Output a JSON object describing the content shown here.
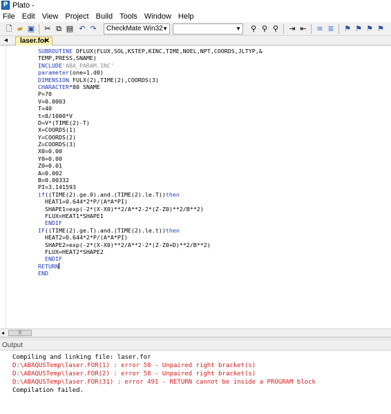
{
  "window": {
    "title": "Plato -",
    "app_icon": "plato-app-icon"
  },
  "menu": [
    "File",
    "Edit",
    "View",
    "Project",
    "Build",
    "Tools",
    "Window",
    "Help"
  ],
  "toolbar": {
    "build_config": "CheckMate Win32",
    "second_combo": "",
    "icons": [
      "new-file-icon",
      "open-folder-icon",
      "save-icon",
      "cut-icon",
      "copy-icon",
      "paste-icon",
      "undo-icon",
      "redo-icon",
      "binoculars-find-icon",
      "find-next-icon",
      "find-in-files-icon",
      "indent-icon",
      "outdent-icon",
      "comment-icon",
      "uncomment-icon",
      "bookmark-icon",
      "next-bookmark-icon",
      "prev-bookmark-icon",
      "clear-bookmarks-icon"
    ]
  },
  "tab": {
    "label": "laser.for"
  },
  "code": [
    [
      [
        "kw",
        "SUBROUTINE"
      ],
      [
        "t",
        " DFLUX(FLUX,SOL,KSTEP,KINC,TIME,NOEL,NPT,COORDS,JLTYP,&"
      ]
    ],
    [
      [
        "t",
        "TEMP,PRESS,SNAME)"
      ]
    ],
    [
      [
        "kw",
        "INCLUDE"
      ],
      [
        "str",
        "'ABA_PARAM.INC'"
      ]
    ],
    [
      [
        "kw",
        "parameter"
      ],
      [
        "t",
        "(one=1.d0)"
      ]
    ],
    [
      [
        "kw",
        "DIMENSION"
      ],
      [
        "t",
        " FULX(2),TIME(2),COORDS(3)"
      ]
    ],
    [
      [
        "kw",
        "CHARACTER"
      ],
      [
        "t",
        "*80 SNAME"
      ]
    ],
    [
      [
        "t",
        "P=70"
      ]
    ],
    [
      [
        "t",
        "V=0.0003"
      ]
    ],
    [
      [
        "t",
        "T=40"
      ]
    ],
    [
      [
        "t",
        "t=8/1000*V"
      ]
    ],
    [
      [
        "t",
        "D=V*(TIME(2)-T)"
      ]
    ],
    [
      [
        "t",
        "X=COORDS(1)"
      ]
    ],
    [
      [
        "t",
        "Y=COORDS(2)"
      ]
    ],
    [
      [
        "t",
        "Z=COORDS(3)"
      ]
    ],
    [
      [
        "t",
        "X0=0.00"
      ]
    ],
    [
      [
        "t",
        "Y0=0.00"
      ]
    ],
    [
      [
        "t",
        "Z0=0.01"
      ]
    ],
    [
      [
        "t",
        "A=0.002"
      ]
    ],
    [
      [
        "t",
        "B=0.00332"
      ]
    ],
    [
      [
        "t",
        "PI=3.141593"
      ]
    ],
    [
      [
        "kw",
        "if"
      ],
      [
        "t",
        "((TIME(2).ge.0).and.(TIME(2).le.T))"
      ],
      [
        "kw",
        "then"
      ]
    ],
    [
      [
        "t",
        "  HEAT1=0.644*2*P/(A*A*PI)"
      ]
    ],
    [
      [
        "t",
        "  SHAPE1=exp(-2*(X-X0)**2/A**2-2*(Z-Z0)**2/B**2)"
      ]
    ],
    [
      [
        "t",
        "  FLUX=HEAT1*SHAPE1"
      ]
    ],
    [
      [
        "kw",
        "  ENDIF"
      ]
    ],
    [
      [
        "kw",
        "IF"
      ],
      [
        "t",
        "((TIME(2).ge.T).and.(TIME(2).le.t))"
      ],
      [
        "kw",
        "then"
      ]
    ],
    [
      [
        "t",
        "  HEAT2=0.644*2*P/(A*A*PI)"
      ]
    ],
    [
      [
        "t",
        "  SHAPE2=exp(-2*(X-X0)**2/A**2-2*(Z-Z0+D)**2/B**2)"
      ]
    ],
    [
      [
        "t",
        "  FLUX=HEAT2*SHAPE2"
      ]
    ],
    [
      [
        "kw",
        "  ENDIF"
      ]
    ],
    [
      [
        "kw",
        "RETURN"
      ],
      [
        "cursor",
        ""
      ]
    ],
    [
      [
        "kw",
        "END"
      ]
    ]
  ],
  "output": {
    "title": "Output",
    "lines": [
      {
        "text": "Compiling and linking file: laser.for",
        "type": "info"
      },
      {
        "text": "D:\\ABAQUSTemp\\laser.FOR(1) : error 58 - Unpaired right bracket(s)",
        "type": "error"
      },
      {
        "text": "D:\\ABAQUSTemp\\laser.FOR(2) : error 58 - Unpaired right bracket(s)",
        "type": "error"
      },
      {
        "text": "D:\\ABAQUSTemp\\laser.FOR(31) : error 491 - RETURN cannot be inside a PROGRAM block",
        "type": "error"
      },
      {
        "text": "Compilation failed.",
        "type": "info"
      }
    ]
  },
  "colors": {
    "keyword": "#1f3bb3",
    "string": "#8d8d8d",
    "error": "#d01c1c",
    "active_tab": "#fef3b2"
  }
}
